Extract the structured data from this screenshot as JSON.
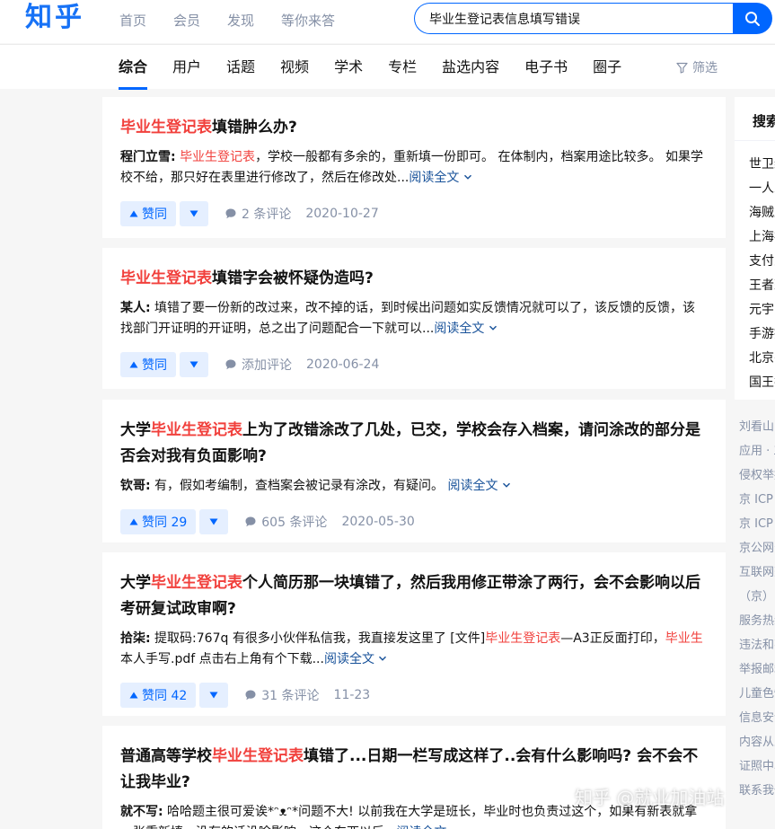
{
  "header": {
    "logo": "知乎",
    "nav": [
      "首页",
      "会员",
      "发现",
      "等你来答"
    ],
    "search_value": "毕业生登记表信息填写错误"
  },
  "tabs": {
    "items": [
      "综合",
      "用户",
      "话题",
      "视频",
      "学术",
      "专栏",
      "盐选内容",
      "电子书",
      "圈子"
    ],
    "active": "综合",
    "filter_label": "筛选"
  },
  "results": [
    {
      "title": [
        {
          "t": "毕业生登记表",
          "hl": true
        },
        {
          "t": "填错肿么办?",
          "hl": false
        }
      ],
      "author": "程门立雪:",
      "excerpt": [
        {
          "t": " ",
          "hl": false
        },
        {
          "t": "毕业生登记表",
          "hl": true
        },
        {
          "t": "，学校一般都有多余的，重新填一份即可。 在体制内，档案用途比较多。 如果学校不给，那只好在表里进行修改了，然后在修改处...",
          "hl": false
        }
      ],
      "read_more": "阅读全文",
      "vote_label": "赞同",
      "comments": "2 条评论",
      "date": "2020-10-27"
    },
    {
      "title": [
        {
          "t": "毕业生登记表",
          "hl": true
        },
        {
          "t": "填错字会被怀疑伪造吗?",
          "hl": false
        }
      ],
      "author": "某人:",
      "excerpt": [
        {
          "t": " 填错了要一份新的改过来，改不掉的话，到时候出问题如实反馈情况就可以了，该反馈的反馈，该找部门开证明的开证明，总之出了问题配合一下就可以...",
          "hl": false
        }
      ],
      "read_more": "阅读全文",
      "vote_label": "赞同",
      "comments": "添加评论",
      "date": "2020-06-24"
    },
    {
      "title": [
        {
          "t": "大学",
          "hl": false
        },
        {
          "t": "毕业生登记表",
          "hl": true
        },
        {
          "t": "上为了改错涂改了几处，已交，学校会存入档案，请问涂改的部分是否会对我有负面影响?",
          "hl": false
        }
      ],
      "author": "钦哥:",
      "excerpt": [
        {
          "t": " 有，假如考编制，查档案会被记录有涂改，有疑问。 ",
          "hl": false
        }
      ],
      "read_more": "阅读全文",
      "vote_label": "赞同 29",
      "comments": "605 条评论",
      "date": "2020-05-30"
    },
    {
      "title": [
        {
          "t": "大学",
          "hl": false
        },
        {
          "t": "毕业生登记表",
          "hl": true
        },
        {
          "t": "个人简历那一块填错了，然后我用修正带涂了两行，会不会影响以后考研复试政审啊?",
          "hl": false
        }
      ],
      "author": "拾柒:",
      "excerpt": [
        {
          "t": " 提取码:767q 有很多小伙伴私信我，我直接发这里了 [文件]",
          "hl": false
        },
        {
          "t": "毕业生登记表",
          "hl": true
        },
        {
          "t": "—A3正反面打印，",
          "hl": false
        },
        {
          "t": "毕业生",
          "hl": true
        },
        {
          "t": "本人手写.pdf 点击右上角有个下载...",
          "hl": false
        }
      ],
      "read_more": "阅读全文",
      "vote_label": "赞同 42",
      "comments": "31 条评论",
      "date": "11-23"
    },
    {
      "title": [
        {
          "t": "普通高等学校",
          "hl": false
        },
        {
          "t": "毕业生登记表",
          "hl": true
        },
        {
          "t": "填错了...日期一栏写成这样了..会有什么影响吗? 会不会不让我毕业?",
          "hl": false
        }
      ],
      "author": "就不写:",
      "excerpt": [
        {
          "t": " 哈哈题主很可爱诶*ᵔᴥᵔ*问题不大! 以前我在大学是班长，毕业时也负责过这个，如果有新表就拿一张重新填，没有的话没啥影响，这个东西以后...",
          "hl": false
        }
      ],
      "read_more": "阅读全文",
      "vote_label": "",
      "comments": "",
      "date": ""
    }
  ],
  "sidebar": {
    "title": "搜索发现",
    "items": [
      "世卫组织",
      "一人之下",
      "海贼王",
      "上海疫情",
      "支付宝",
      "王者荣耀",
      "元宇宙",
      "手游推荐",
      "北京冬奥",
      "国王排名"
    ],
    "footer": [
      "刘看山",
      "应用 · 工作",
      "侵权举报",
      "京 ICP 证",
      "京 ICP 备",
      "京公网安备",
      "互联网药品",
      "（京）",
      "服务热线",
      "违法和不良",
      "举报邮箱",
      "儿童色情",
      "信息安全",
      "内容从业",
      "证照中心",
      "联系我们"
    ]
  },
  "watermark": "知乎 @就业加油站",
  "colors": {
    "brand": "#0066ff",
    "highlight": "#f1403c",
    "link": "#175199"
  }
}
